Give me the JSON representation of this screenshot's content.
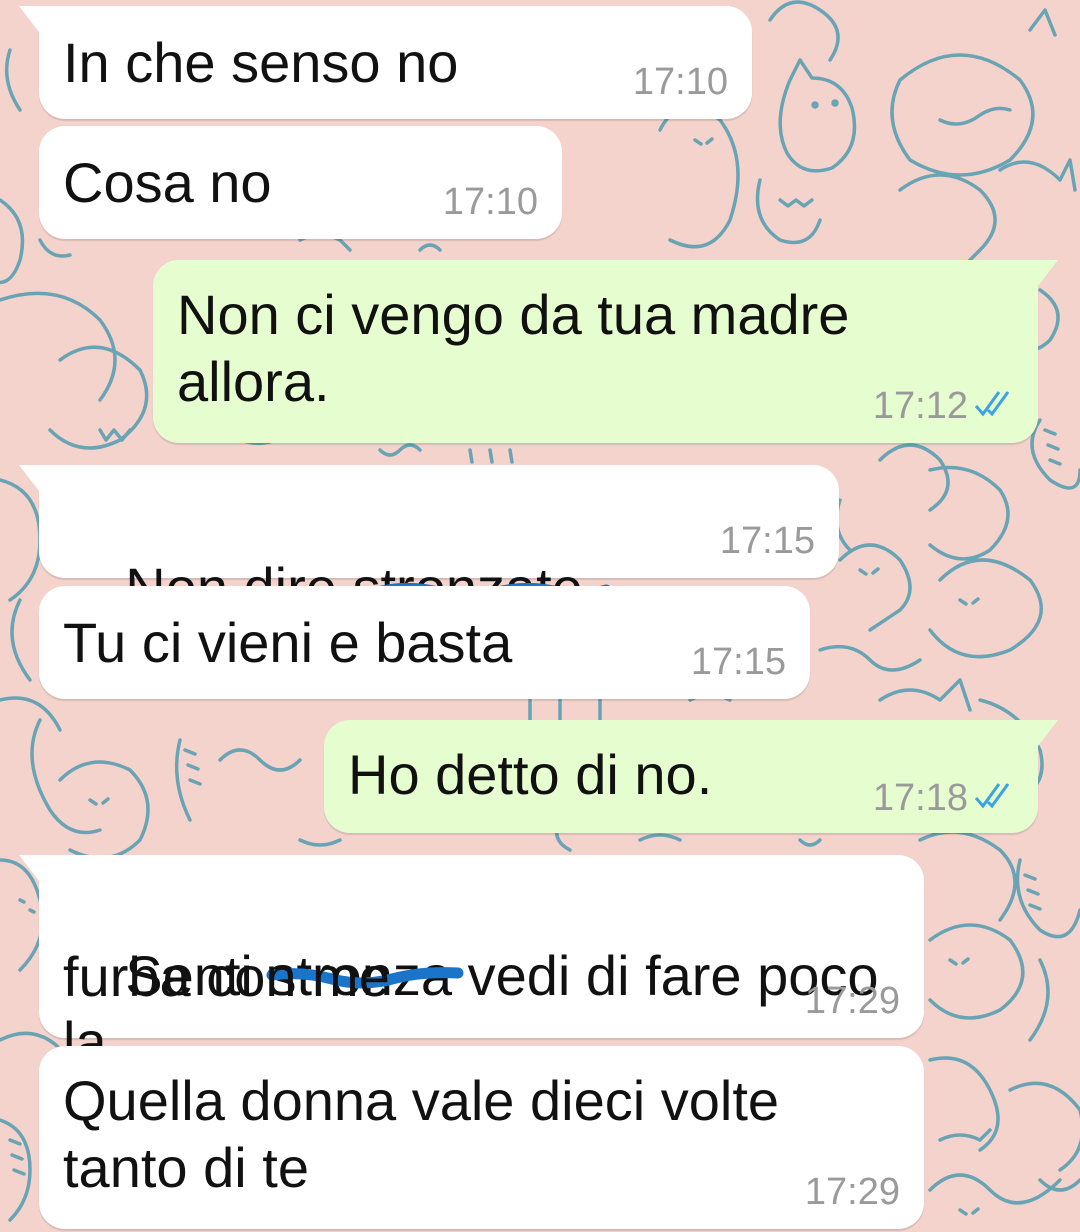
{
  "colors": {
    "wallpaper": "#f5d3cd",
    "doodle_stroke": "#5a9fb3",
    "incoming_bubble": "#ffffff",
    "outgoing_bubble": "#e6fdd0",
    "read_ticks": "#3aa3e3",
    "scribble": "#1a74c9"
  },
  "messages": [
    {
      "direction": "in",
      "text": "In che senso no",
      "time": "17:10"
    },
    {
      "direction": "in",
      "text": "Cosa no",
      "time": "17:10"
    },
    {
      "direction": "out",
      "line1": "Non ci vengo da tua madre",
      "line2": "allora.",
      "time": "17:12",
      "status": "read",
      "status_icon": "double-check-icon"
    },
    {
      "direction": "in",
      "before": "Non dire s",
      "struck": "tronzate",
      "time": "17:15"
    },
    {
      "direction": "in",
      "text": "Tu ci vieni e basta",
      "time": "17:15"
    },
    {
      "direction": "out",
      "text": "Ho detto di no.",
      "time": "17:18",
      "status": "read",
      "status_icon": "double-check-icon"
    },
    {
      "direction": "in",
      "before": "Senti ",
      "struck": "stronza",
      "after": " vedi di fare poco la",
      "line2": "furba con me",
      "time": "17:29"
    },
    {
      "direction": "in",
      "line1": "Quella donna vale dieci volte",
      "line2": "tanto di te",
      "time": "17:29"
    }
  ]
}
